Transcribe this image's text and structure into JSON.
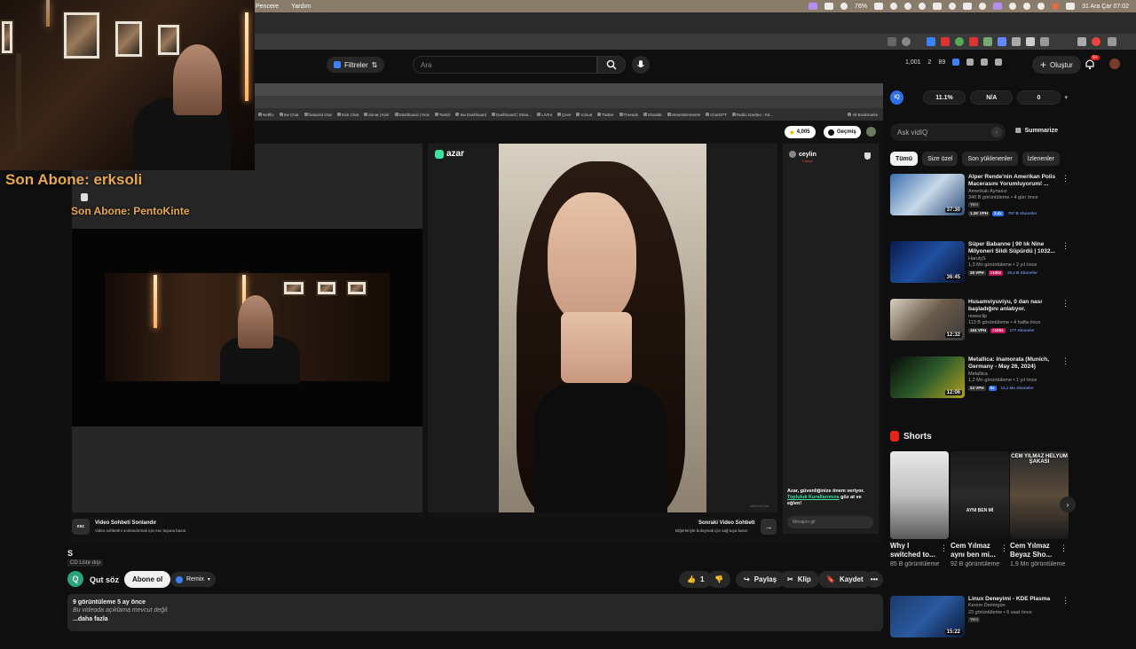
{
  "menubar": {
    "items": [
      "Pencere",
      "Yardım"
    ],
    "battery": "76%",
    "datetime": "31 Ara Çar  07:02"
  },
  "overlay": {
    "last_sub_1": "Son Abone: erksoli",
    "last_sub_2": "Son Abone: PentoKinte"
  },
  "header": {
    "filters_label": "Filtreler",
    "search_placeholder": "Ara",
    "stats": [
      "1,001",
      "2",
      "89"
    ],
    "create_label": "Oluştur",
    "notif_count": "9+"
  },
  "inner_browser": {
    "bookmarks": [
      "Netflix",
      "Sw Chat",
      "featured chat",
      "Kick Chat",
      "donat | Kick",
      "Dashboard | Kick",
      "Twitch",
      "Sw Dashboard",
      "Dashboard | Strea...",
      "LiVKiI",
      "Çevir",
      "iCloud",
      "Twitter",
      "Threads",
      "Gloulab",
      "streamElements",
      "ChatGPT",
      "Radio Gardeo - Kit..."
    ],
    "all_bookmarks": "All Bookmarks",
    "coins": "4,005",
    "history_label": "Geçmiş",
    "app_name": "azar",
    "chat_user": "ceylin",
    "chat_status": "Türkiye",
    "safety_line1": "Azar, güvenliğinize önem veriyor.",
    "safety_link": "Topluluk Kurallarımıza",
    "safety_line2": "göz at ve eğlen!",
    "message_placeholder": "Mesajını gir",
    "end_key": "esc",
    "end_title": "Video Sohbeti Sonlandır",
    "end_sub": "Video sohbetini sonlandırmak için esc tuşuna basın.",
    "next_title": "Sonraki Video Sohbeti",
    "next_sub": "Diğerleriyle buluşmak için sağ tuşa basın",
    "watermark": "d85ecd7d8c"
  },
  "video": {
    "title": "S",
    "cc_label": "CD Liste dışı",
    "channel_initial": "Q",
    "channel_name": "Qut söz",
    "subscribe_label": "Abone ol",
    "remix_label": "Remix",
    "like_count": "1",
    "share_label": "Paylaş",
    "clip_label": "Klip",
    "save_label": "Kaydet",
    "desc_stats": "9 görüntüleme  5 ay önce",
    "desc_text": "Bu videoda açıklama mevcut değil.",
    "desc_more": "...daha fazla"
  },
  "vidiq": {
    "logo": "IQ",
    "score": "11.1%",
    "na": "N/A",
    "zero": "0",
    "ask_placeholder": "Ask vidIQ",
    "summarize_label": "Summarize"
  },
  "chips": [
    "Tümü",
    "Size özel",
    "Son yüklenenler",
    "İzlenenler"
  ],
  "recommendations": [
    {
      "title": "Alper Rende'nin Amerikan Polis Macerasını Yorumluyorum! ...",
      "channel": "Amerikalı Aynasız",
      "meta": "340 B görüntüleme • 4 gün önce",
      "duration": "37:30",
      "tag": "Yeni",
      "vph": "1.2K VPH",
      "mult": "3.4x",
      "subs": "757 B Aboneler"
    },
    {
      "title": "Süper Babanne | 90 lık Nine Milyoneri Sildi Süpürdü | 1032...",
      "channel": "HarulyS",
      "meta": "1,3 Mn görüntüleme • 2 yıl önce",
      "duration": "36:45",
      "tag": "",
      "vph": "26 VPH",
      "mult": ">100x",
      "subs": "20,2 B Aboneler"
    },
    {
      "title": "Husamviyuviyu, 0 dan nası başladığını anlatıyor.",
      "channel": "nowsclip",
      "meta": "113 B görüntüleme • 4 hafta önce",
      "duration": "12:32",
      "tag": "",
      "vph": "164 VPH",
      "mult": ">100x",
      "subs": "177 Aboneler"
    },
    {
      "title": "Metallica: Inamorata (Munich, Germany - May 26, 2024)",
      "channel": "Metallica",
      "meta": "1,2 Mn görüntüleme • 1 yıl önce",
      "duration": "12:06",
      "tag": "",
      "vph": "24 VPH",
      "mult": "5x",
      "subs": "12,1 Mn Aboneler"
    }
  ],
  "shorts": {
    "header": "Shorts",
    "items": [
      {
        "title": "Why I switched to...",
        "views": "85 B görüntüleme",
        "overlay": ""
      },
      {
        "title": "Cem Yılmaz aynı ben mi...",
        "views": "92 B görüntüleme",
        "overlay": "AYNI BEN Mİ"
      },
      {
        "title": "Cem Yılmaz Beyaz Sho...",
        "views": "1,9 Mn görüntüleme",
        "overlay": "CEM YILMAZ HELYUM ŞAKASI"
      }
    ]
  },
  "bottom_rec": {
    "title": "Linux Deneyimi - KDE Plasma",
    "channel": "Kerem Demirgün",
    "meta": "23 görüntüleme • 6 saat önce",
    "duration": "15:22",
    "tag": "Yeni"
  },
  "colors": {
    "accent_gold": "#e8a74e",
    "azar_green": "#3ee0a0",
    "youtube_red": "#e62117",
    "vidiq_blue": "#2b6ee8"
  }
}
